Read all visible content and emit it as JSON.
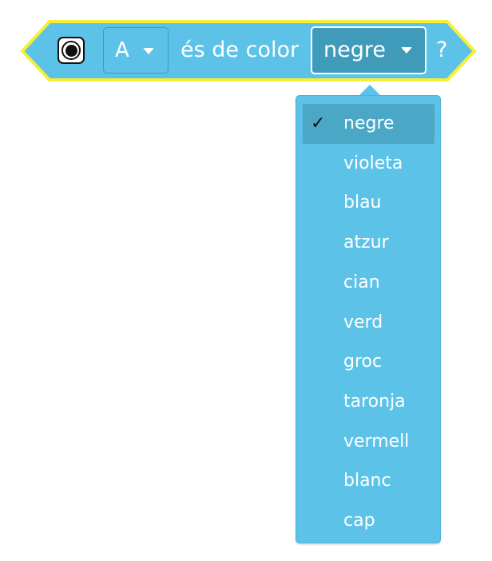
{
  "block": {
    "port_value": "A",
    "text": "és de color",
    "color_value": "negre",
    "question_mark": "?",
    "icon": "color-sensor-icon",
    "colors": {
      "block_fill": "#5cc2e8",
      "block_outline": "#f7ee3a",
      "dropdown_active_fill": "#3f9bb9",
      "text": "#ffffff"
    }
  },
  "menu": {
    "check_mark": "✓",
    "selected_index": 0,
    "items": [
      {
        "label": "negre"
      },
      {
        "label": "violeta"
      },
      {
        "label": "blau"
      },
      {
        "label": "atzur"
      },
      {
        "label": "cian"
      },
      {
        "label": "verd"
      },
      {
        "label": "groc"
      },
      {
        "label": "taronja"
      },
      {
        "label": "vermell"
      },
      {
        "label": "blanc"
      },
      {
        "label": "cap"
      }
    ]
  }
}
